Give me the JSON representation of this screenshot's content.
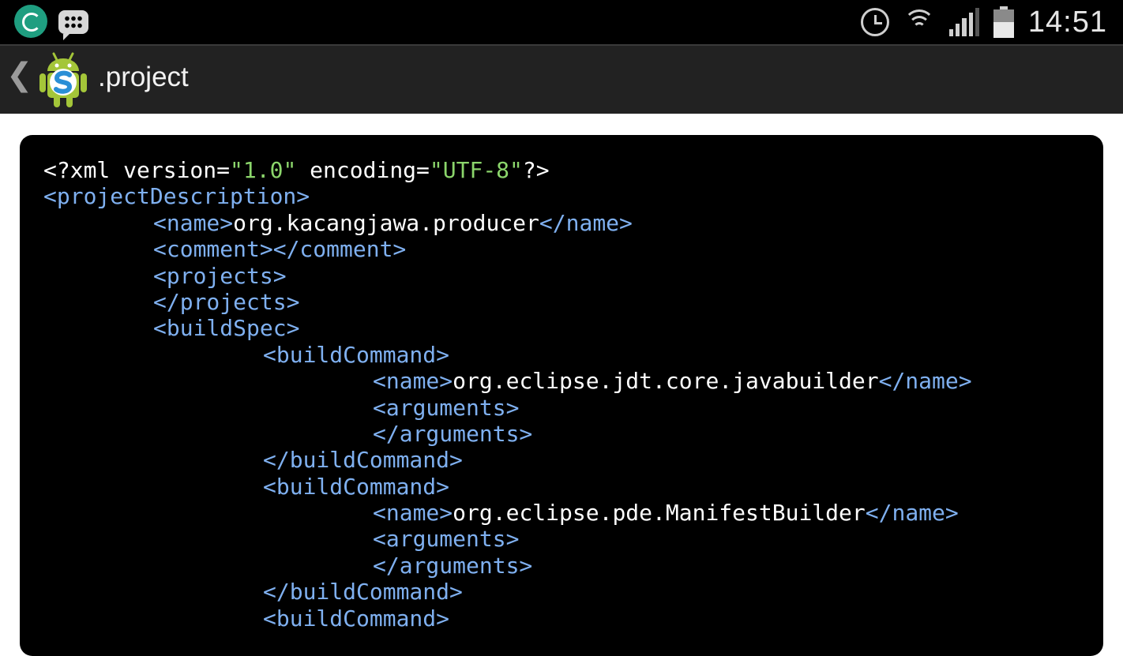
{
  "status_bar": {
    "time": "14:51",
    "icons": [
      "app-notification-icon",
      "bbm-icon",
      "alarm-icon",
      "wifi-icon",
      "signal-icon",
      "battery-icon"
    ],
    "signal_bars": 4,
    "battery_level": 0.55
  },
  "action_bar": {
    "back_icon": "chevron-left-icon",
    "back_glyph": "❮",
    "app_icon": "android-s-logo",
    "title": ".project"
  },
  "colors": {
    "tag": "#7fb0f0",
    "text": "#ffffff",
    "string": "#8bd56b",
    "panel_background": "#000000",
    "action_bar": "#222222"
  },
  "code": {
    "lines": [
      {
        "indent": 0,
        "tokens": [
          {
            "t": "text",
            "v": "<?xml version="
          },
          {
            "t": "str",
            "v": "\"1.0\""
          },
          {
            "t": "text",
            "v": " encoding="
          },
          {
            "t": "str",
            "v": "\"UTF-8\""
          },
          {
            "t": "text",
            "v": "?>"
          }
        ]
      },
      {
        "indent": 0,
        "tokens": [
          {
            "t": "tag",
            "v": "<projectDescription>"
          }
        ]
      },
      {
        "indent": 1,
        "tokens": [
          {
            "t": "tag",
            "v": "<name>"
          },
          {
            "t": "text",
            "v": "org.kacangjawa.producer"
          },
          {
            "t": "tag",
            "v": "</name>"
          }
        ]
      },
      {
        "indent": 1,
        "tokens": [
          {
            "t": "tag",
            "v": "<comment></comment>"
          }
        ]
      },
      {
        "indent": 1,
        "tokens": [
          {
            "t": "tag",
            "v": "<projects>"
          }
        ]
      },
      {
        "indent": 1,
        "tokens": [
          {
            "t": "tag",
            "v": "</projects>"
          }
        ]
      },
      {
        "indent": 1,
        "tokens": [
          {
            "t": "tag",
            "v": "<buildSpec>"
          }
        ]
      },
      {
        "indent": 2,
        "tokens": [
          {
            "t": "tag",
            "v": "<buildCommand>"
          }
        ]
      },
      {
        "indent": 3,
        "tokens": [
          {
            "t": "tag",
            "v": "<name>"
          },
          {
            "t": "text",
            "v": "org.eclipse.jdt.core.javabuilder"
          },
          {
            "t": "tag",
            "v": "</name>"
          }
        ]
      },
      {
        "indent": 3,
        "tokens": [
          {
            "t": "tag",
            "v": "<arguments>"
          }
        ]
      },
      {
        "indent": 3,
        "tokens": [
          {
            "t": "tag",
            "v": "</arguments>"
          }
        ]
      },
      {
        "indent": 2,
        "tokens": [
          {
            "t": "tag",
            "v": "</buildCommand>"
          }
        ]
      },
      {
        "indent": 2,
        "tokens": [
          {
            "t": "tag",
            "v": "<buildCommand>"
          }
        ]
      },
      {
        "indent": 3,
        "tokens": [
          {
            "t": "tag",
            "v": "<name>"
          },
          {
            "t": "text",
            "v": "org.eclipse.pde.ManifestBuilder"
          },
          {
            "t": "tag",
            "v": "</name>"
          }
        ]
      },
      {
        "indent": 3,
        "tokens": [
          {
            "t": "tag",
            "v": "<arguments>"
          }
        ]
      },
      {
        "indent": 3,
        "tokens": [
          {
            "t": "tag",
            "v": "</arguments>"
          }
        ]
      },
      {
        "indent": 2,
        "tokens": [
          {
            "t": "tag",
            "v": "</buildCommand>"
          }
        ]
      },
      {
        "indent": 2,
        "tokens": [
          {
            "t": "tag",
            "v": "<buildCommand>"
          }
        ]
      }
    ]
  }
}
